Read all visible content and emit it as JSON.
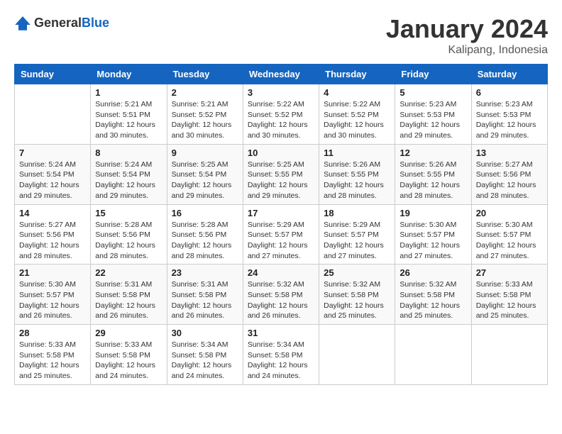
{
  "logo": {
    "general": "General",
    "blue": "Blue"
  },
  "title": "January 2024",
  "location": "Kalipang, Indonesia",
  "days_of_week": [
    "Sunday",
    "Monday",
    "Tuesday",
    "Wednesday",
    "Thursday",
    "Friday",
    "Saturday"
  ],
  "weeks": [
    [
      {
        "day": "",
        "sunrise": "",
        "sunset": "",
        "daylight": ""
      },
      {
        "day": "1",
        "sunrise": "Sunrise: 5:21 AM",
        "sunset": "Sunset: 5:51 PM",
        "daylight": "Daylight: 12 hours and 30 minutes."
      },
      {
        "day": "2",
        "sunrise": "Sunrise: 5:21 AM",
        "sunset": "Sunset: 5:52 PM",
        "daylight": "Daylight: 12 hours and 30 minutes."
      },
      {
        "day": "3",
        "sunrise": "Sunrise: 5:22 AM",
        "sunset": "Sunset: 5:52 PM",
        "daylight": "Daylight: 12 hours and 30 minutes."
      },
      {
        "day": "4",
        "sunrise": "Sunrise: 5:22 AM",
        "sunset": "Sunset: 5:52 PM",
        "daylight": "Daylight: 12 hours and 30 minutes."
      },
      {
        "day": "5",
        "sunrise": "Sunrise: 5:23 AM",
        "sunset": "Sunset: 5:53 PM",
        "daylight": "Daylight: 12 hours and 29 minutes."
      },
      {
        "day": "6",
        "sunrise": "Sunrise: 5:23 AM",
        "sunset": "Sunset: 5:53 PM",
        "daylight": "Daylight: 12 hours and 29 minutes."
      }
    ],
    [
      {
        "day": "7",
        "sunrise": "Sunrise: 5:24 AM",
        "sunset": "Sunset: 5:54 PM",
        "daylight": "Daylight: 12 hours and 29 minutes."
      },
      {
        "day": "8",
        "sunrise": "Sunrise: 5:24 AM",
        "sunset": "Sunset: 5:54 PM",
        "daylight": "Daylight: 12 hours and 29 minutes."
      },
      {
        "day": "9",
        "sunrise": "Sunrise: 5:25 AM",
        "sunset": "Sunset: 5:54 PM",
        "daylight": "Daylight: 12 hours and 29 minutes."
      },
      {
        "day": "10",
        "sunrise": "Sunrise: 5:25 AM",
        "sunset": "Sunset: 5:55 PM",
        "daylight": "Daylight: 12 hours and 29 minutes."
      },
      {
        "day": "11",
        "sunrise": "Sunrise: 5:26 AM",
        "sunset": "Sunset: 5:55 PM",
        "daylight": "Daylight: 12 hours and 28 minutes."
      },
      {
        "day": "12",
        "sunrise": "Sunrise: 5:26 AM",
        "sunset": "Sunset: 5:55 PM",
        "daylight": "Daylight: 12 hours and 28 minutes."
      },
      {
        "day": "13",
        "sunrise": "Sunrise: 5:27 AM",
        "sunset": "Sunset: 5:56 PM",
        "daylight": "Daylight: 12 hours and 28 minutes."
      }
    ],
    [
      {
        "day": "14",
        "sunrise": "Sunrise: 5:27 AM",
        "sunset": "Sunset: 5:56 PM",
        "daylight": "Daylight: 12 hours and 28 minutes."
      },
      {
        "day": "15",
        "sunrise": "Sunrise: 5:28 AM",
        "sunset": "Sunset: 5:56 PM",
        "daylight": "Daylight: 12 hours and 28 minutes."
      },
      {
        "day": "16",
        "sunrise": "Sunrise: 5:28 AM",
        "sunset": "Sunset: 5:56 PM",
        "daylight": "Daylight: 12 hours and 28 minutes."
      },
      {
        "day": "17",
        "sunrise": "Sunrise: 5:29 AM",
        "sunset": "Sunset: 5:57 PM",
        "daylight": "Daylight: 12 hours and 27 minutes."
      },
      {
        "day": "18",
        "sunrise": "Sunrise: 5:29 AM",
        "sunset": "Sunset: 5:57 PM",
        "daylight": "Daylight: 12 hours and 27 minutes."
      },
      {
        "day": "19",
        "sunrise": "Sunrise: 5:30 AM",
        "sunset": "Sunset: 5:57 PM",
        "daylight": "Daylight: 12 hours and 27 minutes."
      },
      {
        "day": "20",
        "sunrise": "Sunrise: 5:30 AM",
        "sunset": "Sunset: 5:57 PM",
        "daylight": "Daylight: 12 hours and 27 minutes."
      }
    ],
    [
      {
        "day": "21",
        "sunrise": "Sunrise: 5:30 AM",
        "sunset": "Sunset: 5:57 PM",
        "daylight": "Daylight: 12 hours and 26 minutes."
      },
      {
        "day": "22",
        "sunrise": "Sunrise: 5:31 AM",
        "sunset": "Sunset: 5:58 PM",
        "daylight": "Daylight: 12 hours and 26 minutes."
      },
      {
        "day": "23",
        "sunrise": "Sunrise: 5:31 AM",
        "sunset": "Sunset: 5:58 PM",
        "daylight": "Daylight: 12 hours and 26 minutes."
      },
      {
        "day": "24",
        "sunrise": "Sunrise: 5:32 AM",
        "sunset": "Sunset: 5:58 PM",
        "daylight": "Daylight: 12 hours and 26 minutes."
      },
      {
        "day": "25",
        "sunrise": "Sunrise: 5:32 AM",
        "sunset": "Sunset: 5:58 PM",
        "daylight": "Daylight: 12 hours and 25 minutes."
      },
      {
        "day": "26",
        "sunrise": "Sunrise: 5:32 AM",
        "sunset": "Sunset: 5:58 PM",
        "daylight": "Daylight: 12 hours and 25 minutes."
      },
      {
        "day": "27",
        "sunrise": "Sunrise: 5:33 AM",
        "sunset": "Sunset: 5:58 PM",
        "daylight": "Daylight: 12 hours and 25 minutes."
      }
    ],
    [
      {
        "day": "28",
        "sunrise": "Sunrise: 5:33 AM",
        "sunset": "Sunset: 5:58 PM",
        "daylight": "Daylight: 12 hours and 25 minutes."
      },
      {
        "day": "29",
        "sunrise": "Sunrise: 5:33 AM",
        "sunset": "Sunset: 5:58 PM",
        "daylight": "Daylight: 12 hours and 24 minutes."
      },
      {
        "day": "30",
        "sunrise": "Sunrise: 5:34 AM",
        "sunset": "Sunset: 5:58 PM",
        "daylight": "Daylight: 12 hours and 24 minutes."
      },
      {
        "day": "31",
        "sunrise": "Sunrise: 5:34 AM",
        "sunset": "Sunset: 5:58 PM",
        "daylight": "Daylight: 12 hours and 24 minutes."
      },
      {
        "day": "",
        "sunrise": "",
        "sunset": "",
        "daylight": ""
      },
      {
        "day": "",
        "sunrise": "",
        "sunset": "",
        "daylight": ""
      },
      {
        "day": "",
        "sunrise": "",
        "sunset": "",
        "daylight": ""
      }
    ]
  ]
}
